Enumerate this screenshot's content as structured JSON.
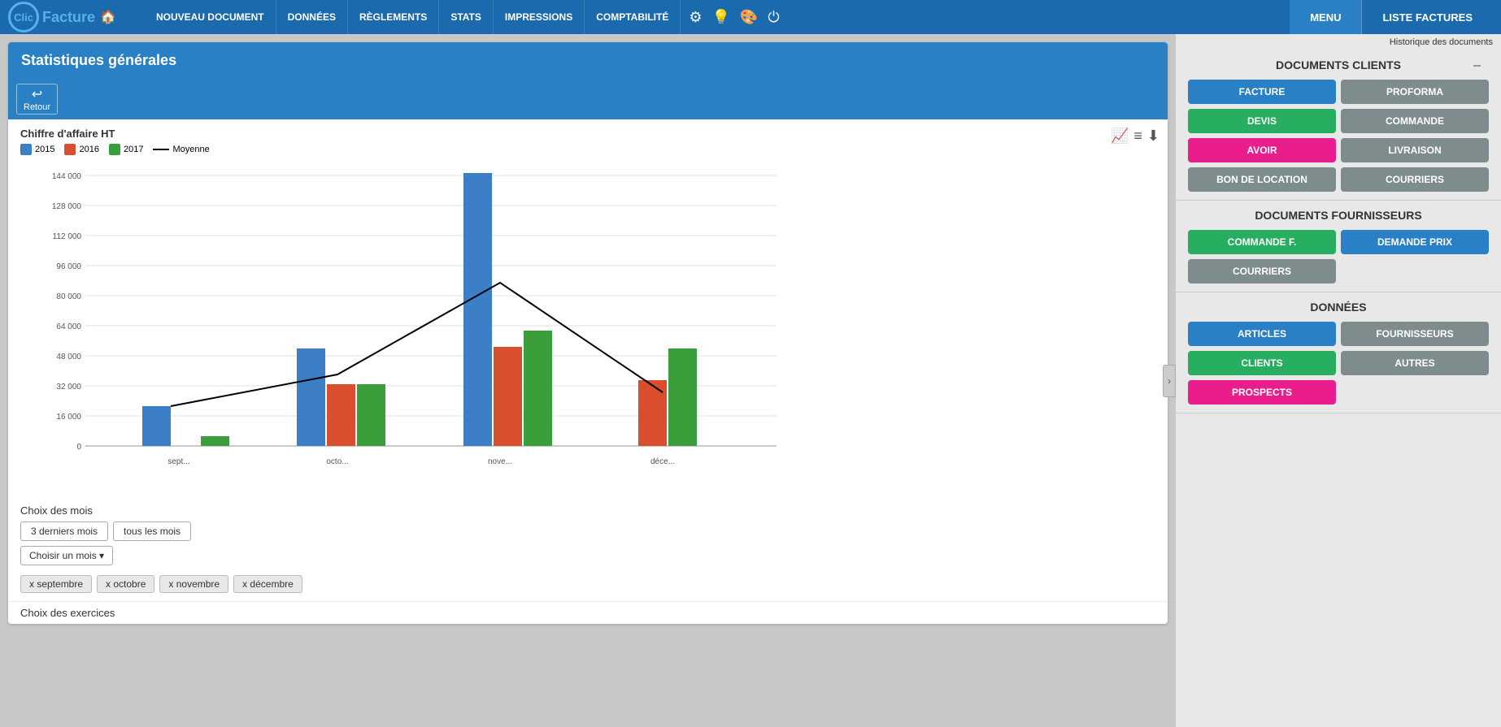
{
  "app": {
    "logo": "Clic",
    "logo2": "Facture"
  },
  "nav": {
    "items": [
      {
        "label": "NOUVEAU DOCUMENT"
      },
      {
        "label": "DONNÉES"
      },
      {
        "label": "RÈGLEMENTS"
      },
      {
        "label": "STATS"
      },
      {
        "label": "IMPRESSIONS"
      },
      {
        "label": "COMPTABILITÉ"
      }
    ],
    "icons": [
      "⚙",
      "💡",
      "🎨",
      "⏻"
    ],
    "right": [
      {
        "label": "MENU"
      },
      {
        "label": "LISTE FACTURES"
      }
    ]
  },
  "rightPanel": {
    "historyLabel": "Historique des documents",
    "collapseIcon": "›",
    "documentsClients": {
      "title": "DOCUMENTS CLIENTS",
      "minimizeIcon": "–",
      "buttons": [
        {
          "label": "FACTURE",
          "color": "blue",
          "name": "facture-btn"
        },
        {
          "label": "PROFORMA",
          "color": "gray",
          "name": "proforma-btn"
        },
        {
          "label": "DEVIS",
          "color": "green",
          "name": "devis-btn"
        },
        {
          "label": "COMMANDE",
          "color": "gray",
          "name": "commande-btn"
        },
        {
          "label": "AVOIR",
          "color": "pink",
          "name": "avoir-btn"
        },
        {
          "label": "LIVRAISON",
          "color": "gray",
          "name": "livraison-btn"
        },
        {
          "label": "BON DE LOCATION",
          "color": "gray",
          "name": "bon-location-btn"
        },
        {
          "label": "COURRIERS",
          "color": "gray",
          "name": "courriers-clients-btn"
        }
      ]
    },
    "documentsFournisseurs": {
      "title": "DOCUMENTS FOURNISSEURS",
      "buttons": [
        {
          "label": "COMMANDE F.",
          "color": "green",
          "name": "commande-f-btn"
        },
        {
          "label": "DEMANDE PRIX",
          "color": "blue",
          "name": "demande-prix-btn"
        },
        {
          "label": "COURRIERS",
          "color": "gray",
          "name": "courriers-fournisseurs-btn"
        }
      ]
    },
    "donnees": {
      "title": "DONNÉES",
      "buttons": [
        {
          "label": "ARTICLES",
          "color": "blue",
          "name": "articles-btn"
        },
        {
          "label": "FOURNISSEURS",
          "color": "gray",
          "name": "fournisseurs-btn"
        },
        {
          "label": "CLIENTS",
          "color": "green",
          "name": "clients-btn"
        },
        {
          "label": "AUTRES",
          "color": "gray",
          "name": "autres-btn"
        },
        {
          "label": "PROSPECTS",
          "color": "pink",
          "name": "prospects-btn"
        }
      ]
    }
  },
  "main": {
    "title": "Statistiques générales",
    "backLabel": "Retour",
    "chart": {
      "title": "Chiffre d'affaire HT",
      "legend": [
        {
          "label": "2015",
          "color": "#3d7fc7",
          "type": "bar"
        },
        {
          "label": "2016",
          "color": "#d94f2e",
          "type": "bar"
        },
        {
          "label": "2017",
          "color": "#3a9e3a",
          "type": "bar"
        },
        {
          "label": "Moyenne",
          "color": "#000000",
          "type": "line"
        }
      ],
      "yAxis": [
        "144 000",
        "128 000",
        "112 000",
        "96 000",
        "80 000",
        "64 000",
        "48 000",
        "32 000",
        "16 000",
        "0"
      ],
      "xAxis": [
        "sept...",
        "octo...",
        "nove...",
        "déce..."
      ],
      "series": {
        "2015": [
          20000,
          49000,
          137000,
          0
        ],
        "2016": [
          0,
          31000,
          50000,
          33000
        ],
        "2017": [
          5000,
          31000,
          58000,
          49000
        ]
      },
      "average": [
        [
          0,
          20000
        ],
        [
          1,
          36000
        ],
        [
          2,
          82000
        ],
        [
          3,
          27000
        ]
      ]
    },
    "monthFilter": {
      "label": "Choix des mois",
      "buttons": [
        "3 derniers mois",
        "tous les mois"
      ],
      "selectLabel": "Choisir un mois",
      "tags": [
        "x septembre",
        "x octobre",
        "x novembre",
        "x décembre"
      ]
    },
    "exerciceFilter": {
      "label": "Choix des exercices"
    }
  }
}
